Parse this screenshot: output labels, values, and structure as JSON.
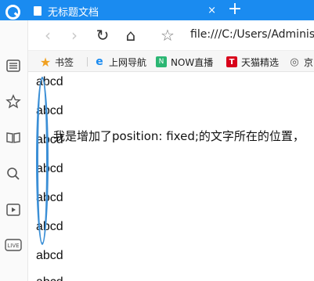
{
  "tab": {
    "title": "无标题文档",
    "close": "×"
  },
  "new_tab": "+",
  "toolbar": {
    "back": "‹",
    "forward": "›",
    "reload": "↻",
    "home": "⌂",
    "favorite": "☆",
    "address": "file:///C:/Users/Adminis"
  },
  "bookmarks": [
    {
      "label": "书签",
      "icon": "star-icon"
    },
    {
      "label": "上网导航",
      "icon": "ie-icon"
    },
    {
      "label": "NOW直播",
      "icon": "now-icon"
    },
    {
      "label": "天猫精选",
      "icon": "tmall-icon"
    },
    {
      "label": "京",
      "icon": "globe-icon"
    }
  ],
  "sidebar": {
    "icons": [
      "list-icon",
      "star-icon",
      "book-icon",
      "search-icon",
      "video-icon",
      "live-icon"
    ],
    "live_label": "LIVE"
  },
  "content": {
    "lines": [
      "abcd",
      "abcd",
      "abcd",
      "abcd",
      "abcd",
      "abcd",
      "abcd"
    ],
    "partial_line": "abcd",
    "fixed_text": "我是增加了position: fixed;的文字所在的位置，"
  },
  "colors": {
    "titlebar": "#1a8bf0",
    "highlight": "#3b8fd6"
  }
}
